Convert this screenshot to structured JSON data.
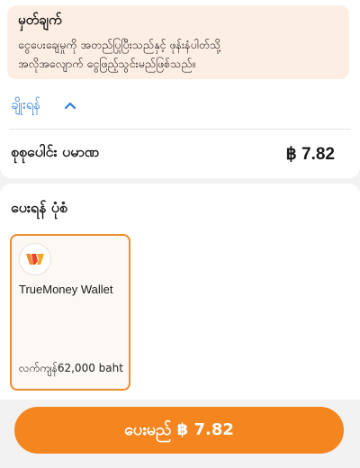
{
  "note": {
    "title": "မှတ်ချက်",
    "line1": "ငွေပေးချေမှုကို အတည်ပြုပြီးသည်နှင့် ဖုန်းနံပါတ်သို့",
    "line2": "အလိုအလျောက် ငွေဖြည့်သွင်းမည်ဖြစ်သည်။"
  },
  "discount": {
    "label": "ချိုးရန်",
    "icon": "chevron-up-icon",
    "accent": "#2f7ed8"
  },
  "total": {
    "label": "စုစုပေါင်း ပမာဏ",
    "value": "฿ 7.82"
  },
  "payment_methods": {
    "title": "ပေးရန် ပုံစံ",
    "selected_color": "#f08c2e",
    "items": [
      {
        "name": "TrueMoney Wallet",
        "balance": "လက်ကျန်62,000 baht",
        "icon": "truemoney-logo-icon"
      }
    ]
  },
  "pay_button": {
    "label": "ပေးမည် ฿ 7.82",
    "color": "#f5861f"
  }
}
